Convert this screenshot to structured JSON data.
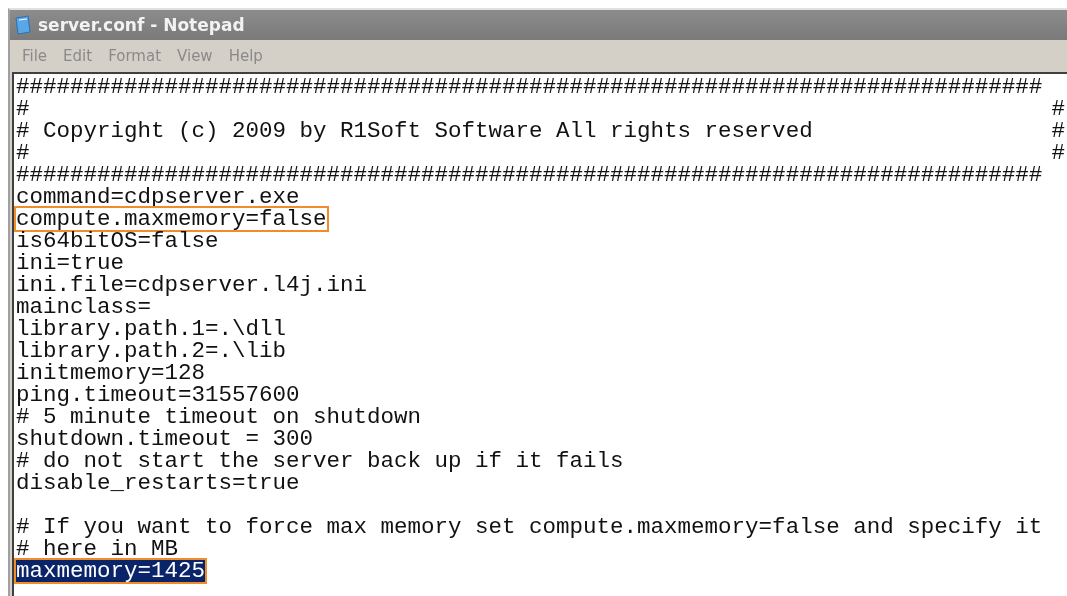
{
  "window": {
    "title": "server.conf - Notepad"
  },
  "menu": [
    "File",
    "Edit",
    "Format",
    "View",
    "Help"
  ],
  "lines": [
    {
      "text": "############################################################################",
      "boxed": false,
      "selected": false
    },
    {
      "text": "#",
      "edge_mark": "#",
      "boxed": false,
      "selected": false
    },
    {
      "text": "# Copyright (c) 2009 by R1Soft Software All rights reserved",
      "edge_mark": "#",
      "boxed": false,
      "selected": false
    },
    {
      "text": "#",
      "edge_mark": "#",
      "boxed": false,
      "selected": false
    },
    {
      "text": "############################################################################",
      "boxed": false,
      "selected": false
    },
    {
      "text": "command=cdpserver.exe",
      "boxed": false,
      "selected": false
    },
    {
      "text": "compute.maxmemory=false",
      "boxed": true,
      "selected": false
    },
    {
      "text": "is64bitOS=false",
      "boxed": false,
      "selected": false
    },
    {
      "text": "ini=true",
      "boxed": false,
      "selected": false
    },
    {
      "text": "ini.file=cdpserver.l4j.ini",
      "boxed": false,
      "selected": false
    },
    {
      "text": "mainclass=",
      "boxed": false,
      "selected": false
    },
    {
      "text": "library.path.1=.\\dll",
      "boxed": false,
      "selected": false
    },
    {
      "text": "library.path.2=.\\lib",
      "boxed": false,
      "selected": false
    },
    {
      "text": "initmemory=128",
      "boxed": false,
      "selected": false
    },
    {
      "text": "ping.timeout=31557600",
      "boxed": false,
      "selected": false
    },
    {
      "text": "# 5 minute timeout on shutdown",
      "boxed": false,
      "selected": false
    },
    {
      "text": "shutdown.timeout = 300",
      "boxed": false,
      "selected": false
    },
    {
      "text": "# do not start the server back up if it fails",
      "boxed": false,
      "selected": false
    },
    {
      "text": "disable_restarts=true",
      "boxed": false,
      "selected": false
    },
    {
      "boxed": false,
      "selected": false
    },
    {
      "text": "# If you want to force max memory set compute.maxmemory=false and specify it",
      "boxed": false,
      "selected": false
    },
    {
      "text": "# here in MB",
      "boxed": false,
      "selected": false
    },
    {
      "text": "maxmemory=1425",
      "boxed": true,
      "selected": true
    }
  ]
}
